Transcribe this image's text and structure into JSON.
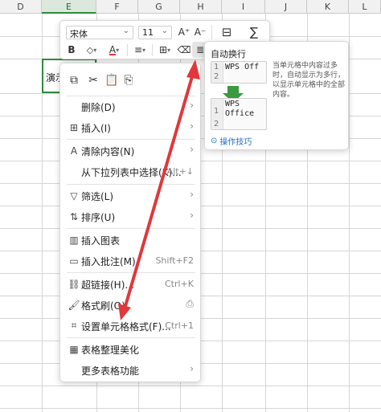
{
  "columns": [
    {
      "id": "col-d",
      "label": "D"
    },
    {
      "id": "col-e",
      "label": "E"
    },
    {
      "id": "col-f",
      "label": "F"
    },
    {
      "id": "col-g",
      "label": "G"
    },
    {
      "id": "col-h",
      "label": "H"
    },
    {
      "id": "col-i",
      "label": "I"
    },
    {
      "id": "col-j",
      "label": "J"
    },
    {
      "id": "col-k",
      "label": "K"
    },
    {
      "id": "col-l",
      "label": "L"
    }
  ],
  "cell": {
    "text": "演示"
  },
  "mini_toolbar": {
    "font_name": "宋体",
    "font_size": "11",
    "grow": "A⁺",
    "shrink": "A⁻",
    "bold": "B"
  },
  "context_menu": {
    "items": [
      {
        "label": "删除(D)",
        "shortcut": "",
        "arrow": true,
        "icon": ""
      },
      {
        "label": "插入(I)",
        "shortcut": "",
        "arrow": true,
        "icon": "⊞"
      },
      {
        "label": "清除内容(N)",
        "shortcut": "",
        "arrow": true,
        "icon": "A"
      },
      {
        "label": "从下拉列表中选择(K)...",
        "shortcut": "Alt+↓",
        "arrow": false,
        "icon": ""
      },
      {
        "label": "筛选(L)",
        "shortcut": "",
        "arrow": true,
        "icon": "▽"
      },
      {
        "label": "排序(U)",
        "shortcut": "",
        "arrow": true,
        "icon": "⇅"
      },
      {
        "label": "插入图表",
        "shortcut": "",
        "arrow": false,
        "icon": "▥"
      },
      {
        "label": "插入批注(M)",
        "shortcut": "Shift+F2",
        "arrow": false,
        "icon": "▭"
      },
      {
        "label": "超链接(H)...",
        "shortcut": "Ctrl+K",
        "arrow": false,
        "icon": "⛓"
      },
      {
        "label": "格式刷(O)",
        "shortcut": "",
        "arrow": false,
        "icon": "🖌"
      },
      {
        "label": "设置单元格格式(F)...",
        "shortcut": "Ctrl+1",
        "arrow": false,
        "icon": "⌗"
      },
      {
        "label": "表格整理美化",
        "shortcut": "",
        "arrow": false,
        "icon": "▦"
      },
      {
        "label": "更多表格功能",
        "shortcut": "",
        "arrow": true,
        "icon": "⊞"
      }
    ]
  },
  "tooltip": {
    "title": "自动换行",
    "desc": "当单元格中内容过多时，自动显示为多行，以显示单元格中的全部内容。",
    "before_rows": [
      "1",
      "2"
    ],
    "before_text": "WPS Off",
    "after_rows": [
      "1",
      "2"
    ],
    "after_text": "WPS\nOffice",
    "link": "操作技巧"
  },
  "colors": {
    "green": "#2f8a3c",
    "red": "#e0383b",
    "accent": "#1f6fd1"
  }
}
